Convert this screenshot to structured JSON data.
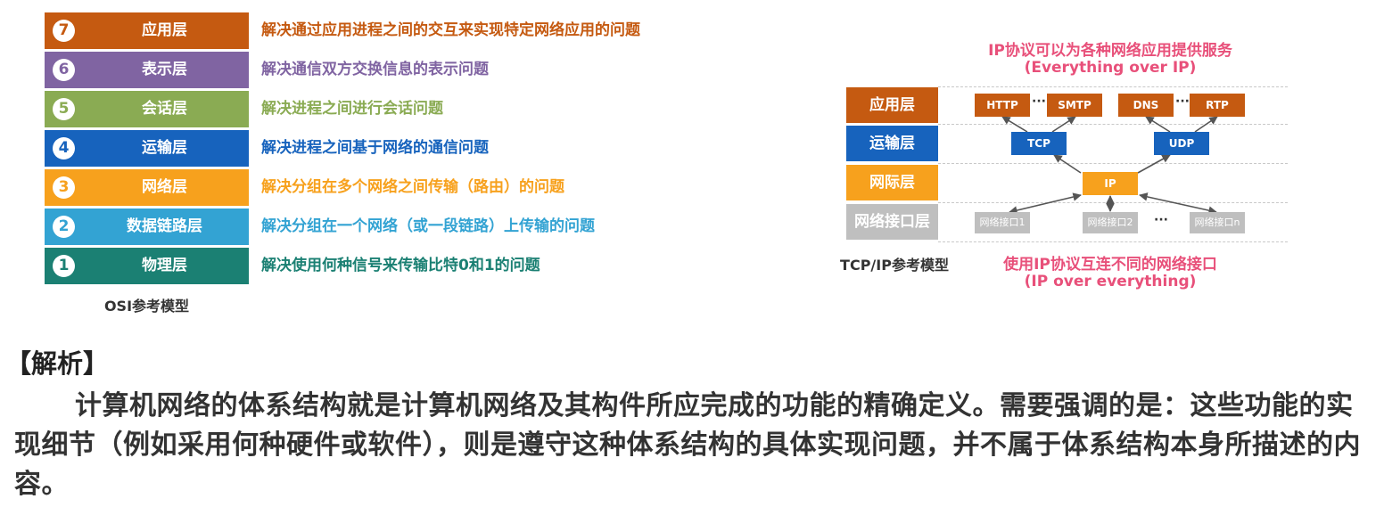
{
  "osi": {
    "caption": "OSI参考模型",
    "layers": [
      {
        "num": "7",
        "name": "应用层",
        "desc": "解决通过应用进程之间的交互来实现特定网络应用的问题",
        "color": "#c55a11"
      },
      {
        "num": "6",
        "name": "表示层",
        "desc": "解决通信双方交换信息的表示问题",
        "color": "#8064a2"
      },
      {
        "num": "5",
        "name": "会话层",
        "desc": "解决进程之间进行会话问题",
        "color": "#8aab53"
      },
      {
        "num": "4",
        "name": "运输层",
        "desc": "解决进程之间基于网络的通信问题",
        "color": "#1763bd"
      },
      {
        "num": "3",
        "name": "网络层",
        "desc": "解决分组在多个网络之间传输（路由）的问题",
        "color": "#f7a11d"
      },
      {
        "num": "2",
        "name": "数据链路层",
        "desc": "解决分组在一个网络（或一段链路）上传输的问题",
        "color": "#33a3d3"
      },
      {
        "num": "1",
        "name": "物理层",
        "desc": "解决使用何种信号来传输比特0和1的问题",
        "color": "#1b8073"
      }
    ]
  },
  "tcpip": {
    "caption": "TCP/IP参考模型",
    "top_note": [
      "IP协议可以为各种网络应用提供服务",
      "(Everything over IP)"
    ],
    "bottom_note": [
      "使用IP协议互连不同的网络接口",
      "(IP over everything)"
    ],
    "layers": [
      {
        "name": "应用层",
        "color": "#c55a11"
      },
      {
        "name": "运输层",
        "color": "#1763bd"
      },
      {
        "name": "网际层",
        "color": "#f7a11d"
      },
      {
        "name": "网络接口层",
        "color": "#bfbfbf"
      }
    ],
    "app_protocols": [
      "HTTP",
      "SMTP",
      "DNS",
      "RTP"
    ],
    "transport_protocols": [
      "TCP",
      "UDP"
    ],
    "internet_protocol": "IP",
    "interfaces": [
      "网络接口1",
      "网络接口2",
      "网络接口n"
    ],
    "ellipsis": "···"
  },
  "analysis": {
    "heading": "【解析】",
    "body": "计算机网络的体系结构就是计算机网络及其构件所应完成的功能的精确定义。需要强调的是：这些功能的实现细节（例如采用何种硬件或软件），则是遵守这种体系结构的具体实现问题，并不属于体系结构本身所描述的内容。"
  }
}
